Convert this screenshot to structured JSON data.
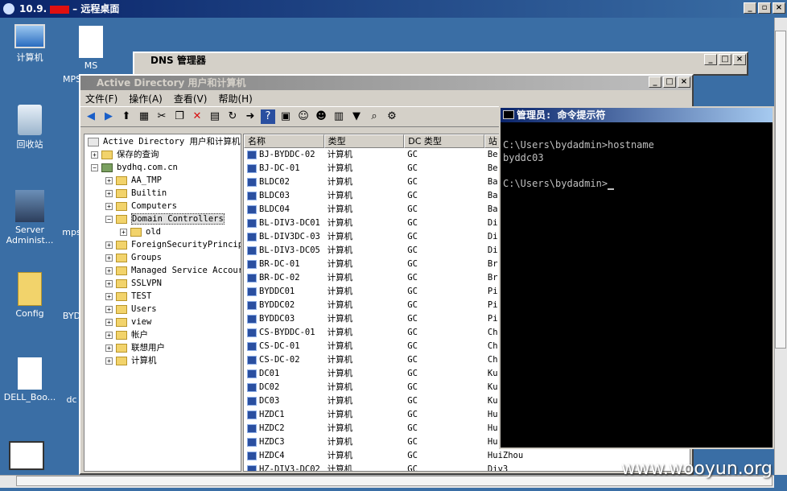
{
  "rdp": {
    "title_prefix": "10.9.",
    "title_suffix": "– 远程桌面"
  },
  "desktop_icons": [
    {
      "label": "计算机"
    },
    {
      "label": "MS"
    },
    {
      "label": "MPS"
    },
    {
      "label": "回收站"
    },
    {
      "label": "Server Administ..."
    },
    {
      "label": "mps"
    },
    {
      "label": "Config"
    },
    {
      "label": "BYD"
    },
    {
      "label": "DELL_Boo..."
    },
    {
      "label": "dc"
    }
  ],
  "dns_window": {
    "title": "DNS 管理器"
  },
  "ad_window": {
    "title": "Active Directory 用户和计算机",
    "menu": [
      "文件(F)",
      "操作(A)",
      "查看(V)",
      "帮助(H)"
    ],
    "tree": {
      "root": "Active Directory 用户和计算机",
      "saved_queries": "保存的查询",
      "domain": "bydhq.com.cn",
      "items": [
        "AA_TMP",
        "Builtin",
        "Computers",
        "Domain Controllers",
        "old",
        "ForeignSecurityPrincip",
        "Groups",
        "Managed Service Accour",
        "SSLVPN",
        "TEST",
        "Users",
        "view",
        "帐户",
        "联想用户",
        "计算机"
      ]
    },
    "columns": [
      "名称",
      "类型",
      "DC 类型",
      "站"
    ],
    "rows": [
      [
        "BJ-BYDDC-02",
        "计算机",
        "GC",
        "Be"
      ],
      [
        "BJ-DC-01",
        "计算机",
        "GC",
        "Be"
      ],
      [
        "BLDC02",
        "计算机",
        "GC",
        "Ba"
      ],
      [
        "BLDC03",
        "计算机",
        "GC",
        "Ba"
      ],
      [
        "BLDC04",
        "计算机",
        "GC",
        "Ba"
      ],
      [
        "BL-DIV3-DC01",
        "计算机",
        "GC",
        "Di"
      ],
      [
        "BL-DIV3DC-03",
        "计算机",
        "GC",
        "Di"
      ],
      [
        "BL-DIV3-DC05",
        "计算机",
        "GC",
        "Di"
      ],
      [
        "BR-DC-01",
        "计算机",
        "GC",
        "Br"
      ],
      [
        "BR-DC-02",
        "计算机",
        "GC",
        "Br"
      ],
      [
        "BYDDC01",
        "计算机",
        "GC",
        "Pi"
      ],
      [
        "BYDDC02",
        "计算机",
        "GC",
        "Pi"
      ],
      [
        "BYDDC03",
        "计算机",
        "GC",
        "Pi"
      ],
      [
        "CS-BYDDC-01",
        "计算机",
        "GC",
        "Ch"
      ],
      [
        "CS-DC-01",
        "计算机",
        "GC",
        "Ch"
      ],
      [
        "CS-DC-02",
        "计算机",
        "GC",
        "Ch"
      ],
      [
        "DC01",
        "计算机",
        "GC",
        "Ku"
      ],
      [
        "DC02",
        "计算机",
        "GC",
        "Ku"
      ],
      [
        "DC03",
        "计算机",
        "GC",
        "Ku"
      ],
      [
        "HZDC1",
        "计算机",
        "GC",
        "Hu"
      ],
      [
        "HZDC2",
        "计算机",
        "GC",
        "Hu"
      ],
      [
        "HZDC3",
        "计算机",
        "GC",
        "Hu"
      ],
      [
        "HZDC4",
        "计算机",
        "GC",
        "HuiZhou"
      ],
      [
        "HZ-DIV3-DC02",
        "计算机",
        "GC",
        "Div3"
      ]
    ]
  },
  "cmd_window": {
    "title": "管理员: 命令提示符",
    "line1": "C:\\Users\\bydadmin>hostname",
    "line2": "byddc03",
    "line3": "C:\\Users\\bydadmin>"
  },
  "watermark": "www.wooyun.org"
}
